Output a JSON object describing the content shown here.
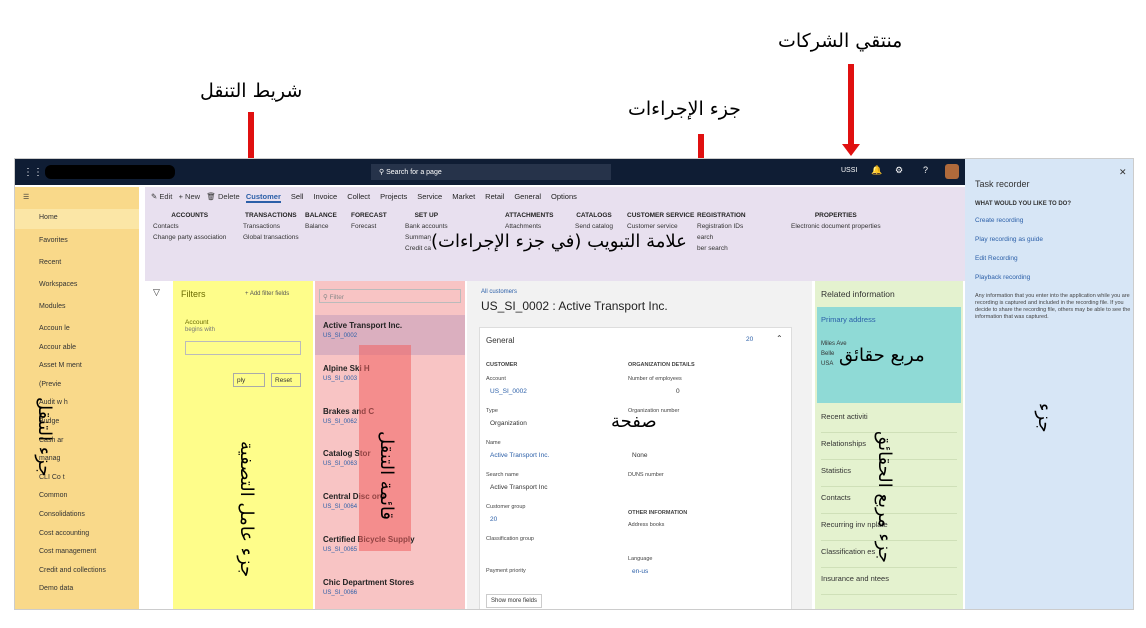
{
  "annotations": {
    "company_picker": "منتقي الشركات",
    "nav_bar": "شريط التنقل",
    "action_pane": "جزء الإجراءات",
    "tab": "علامة التبويب (في جزء الإجراءات)",
    "nav_pane": "جزء التنقل",
    "filter_pane": "جزء عامل التصفية",
    "list_pane": "قائمة التنقل",
    "page": "صفحة",
    "factbox": "مربع حقائق",
    "factbox_pane": "جزء مربع الحقائق",
    "pane": "جزء"
  },
  "topbar": {
    "search_placeholder": "Search for a page",
    "company": "USSI",
    "help": "?"
  },
  "actions": {
    "edit": "Edit",
    "new": "New",
    "delete": "Delete"
  },
  "tabs": [
    "Customer",
    "Sell",
    "Invoice",
    "Collect",
    "Projects",
    "Service",
    "Market",
    "Retail",
    "General",
    "Options"
  ],
  "groups": [
    {
      "title": "ACCOUNTS",
      "items": [
        "Contacts",
        "Change party association"
      ]
    },
    {
      "title": "TRANSACTIONS",
      "items": [
        "Transactions",
        "Global transactions"
      ]
    },
    {
      "title": "BALANCE",
      "items": [
        "Balance"
      ]
    },
    {
      "title": "FORECAST",
      "items": [
        "Forecast"
      ]
    },
    {
      "title": "SET UP",
      "items": [
        "Bank accounts",
        "Summary",
        "Credit cards"
      ]
    },
    {
      "title": "ATTACHMENTS",
      "items": [
        "Attachments"
      ]
    },
    {
      "title": "CATALOGS",
      "items": [
        "Send catalog"
      ]
    },
    {
      "title": "CUSTOMER SERVICE",
      "items": [
        "Customer service"
      ]
    },
    {
      "title": "REGISTRATION",
      "items": [
        "Registration IDs",
        "earch",
        "ber search"
      ]
    },
    {
      "title": "PROPERTIES",
      "items": [
        "Electronic document properties"
      ]
    }
  ],
  "nav": {
    "items": [
      "Home",
      "Favorites",
      "Recent",
      "Workspaces",
      "Modules"
    ],
    "modules": [
      "Accoun     le",
      "Accour        able",
      "Asset M      ment",
      "(Previe",
      "Audit w        h",
      "Budge",
      "Cash ar",
      "manag",
      "CLI Co         t",
      "Common",
      "Consolidations",
      "Cost accounting",
      "Cost management",
      "Credit and collections",
      "Demo data"
    ]
  },
  "filters": {
    "title": "Filters",
    "add": "Add filter fields",
    "field": "Account",
    "op": "begins with",
    "apply": "ply",
    "reset": "Reset"
  },
  "list": {
    "filter_placeholder": "Filter",
    "items": [
      {
        "name": "Active Transport Inc.",
        "id": "US_SI_0002"
      },
      {
        "name": "Alpine Ski H",
        "id": "US_SI_0003"
      },
      {
        "name": "Brakes and C",
        "id": "US_SI_0062"
      },
      {
        "name": "Catalog Stor",
        "id": "US_SI_0063"
      },
      {
        "name": "Central Disc         ore",
        "id": "US_SI_0064"
      },
      {
        "name": "Certified Bicycle Supply",
        "id": "US_SI_0065"
      },
      {
        "name": "Chic Department Stores",
        "id": "US_SI_0066"
      }
    ]
  },
  "page": {
    "breadcrumb": "All customers",
    "title": "US_SI_0002 : Active Transport Inc.",
    "section": "General",
    "count": "20",
    "customer": "CUSTOMER",
    "account_label": "Account",
    "account": "US_SI_0002",
    "type_label": "Type",
    "type": "Organization",
    "name_label": "Name",
    "name": "Active Transport Inc.",
    "search_label": "Search name",
    "search": "Active Transport Inc",
    "group_label": "Customer group",
    "group": "20",
    "class_label": "Classification group",
    "payment_label": "Payment priority",
    "org": "ORGANIZATION DETAILS",
    "emp_label": "Number of employees",
    "emp": "0",
    "orgnum_label": "Organization number",
    "none": "None",
    "duns_label": "DUNS number",
    "other": "OTHER INFORMATION",
    "addr_label": "Address books",
    "lang_label": "Language",
    "lang": "en-us",
    "more": "Show more fields"
  },
  "facts": {
    "title": "Related information",
    "primary": "Primary address",
    "addr": [
      "Miles Ave",
      "Belle",
      "USA"
    ],
    "rows": [
      "Recent activiti",
      "Relationships",
      "Statistics",
      "Contacts",
      "Recurring inv         nplate",
      "Classification         es",
      "Insurance and         ntees"
    ]
  },
  "task": {
    "title": "Task recorder",
    "question": "WHAT WOULD YOU LIKE TO DO?",
    "links": [
      "Create recording",
      "Play recording as guide",
      "Edit Recording",
      "Playback recording"
    ],
    "note": "Any information that you enter into the application while you are recording is captured and included in the recording file. If you decide to share the recording file, others may be able to see the information that was captured."
  }
}
